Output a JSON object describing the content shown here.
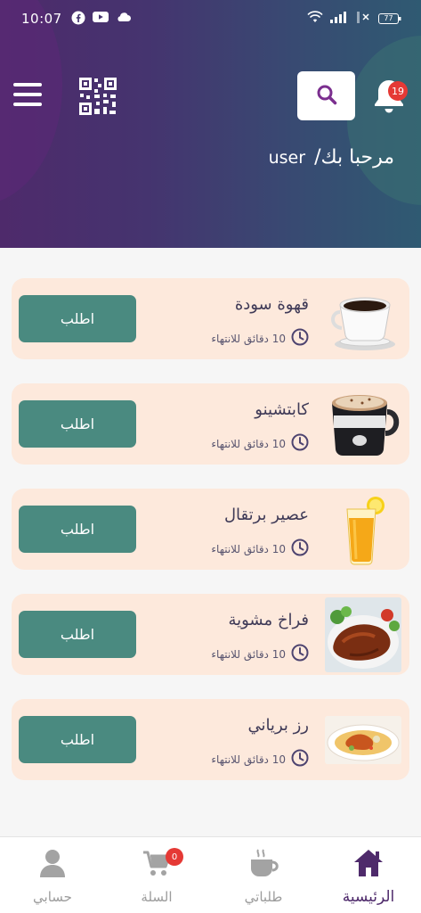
{
  "status_bar": {
    "time": "10:07",
    "battery": "77"
  },
  "header": {
    "greeting": "مرحبا بك/",
    "username": "user",
    "notification_count": "19"
  },
  "items": [
    {
      "title": "قهوة سودة",
      "time_text": "10 دقائق للانتهاء",
      "button": "اطلب",
      "image": "coffee-cup"
    },
    {
      "title": "كابتشينو",
      "time_text": "10 دقائق للانتهاء",
      "button": "اطلب",
      "image": "cappuccino-mug"
    },
    {
      "title": "عصير برتقال",
      "time_text": "10 دقائق للانتهاء",
      "button": "اطلب",
      "image": "orange-juice-glass"
    },
    {
      "title": "فراخ مشوية",
      "time_text": "10 دقائق للانتهاء",
      "button": "اطلب",
      "image": "grilled-chicken-plate"
    },
    {
      "title": "رز برياني",
      "time_text": "10 دقائق للانتهاء",
      "button": "اطلب",
      "image": "biryani-rice-plate"
    }
  ],
  "bottom_nav": {
    "home": "الرئيسية",
    "orders": "طلباتي",
    "cart": "السلة",
    "cart_count": "0",
    "account": "حسابي"
  },
  "colors": {
    "header_start": "#4e2a6b",
    "header_end": "#2f5a72",
    "card_bg": "#fde9dc",
    "button_bg": "#4a8a80",
    "active_nav": "#4e2a6b",
    "badge": "#e53935"
  }
}
